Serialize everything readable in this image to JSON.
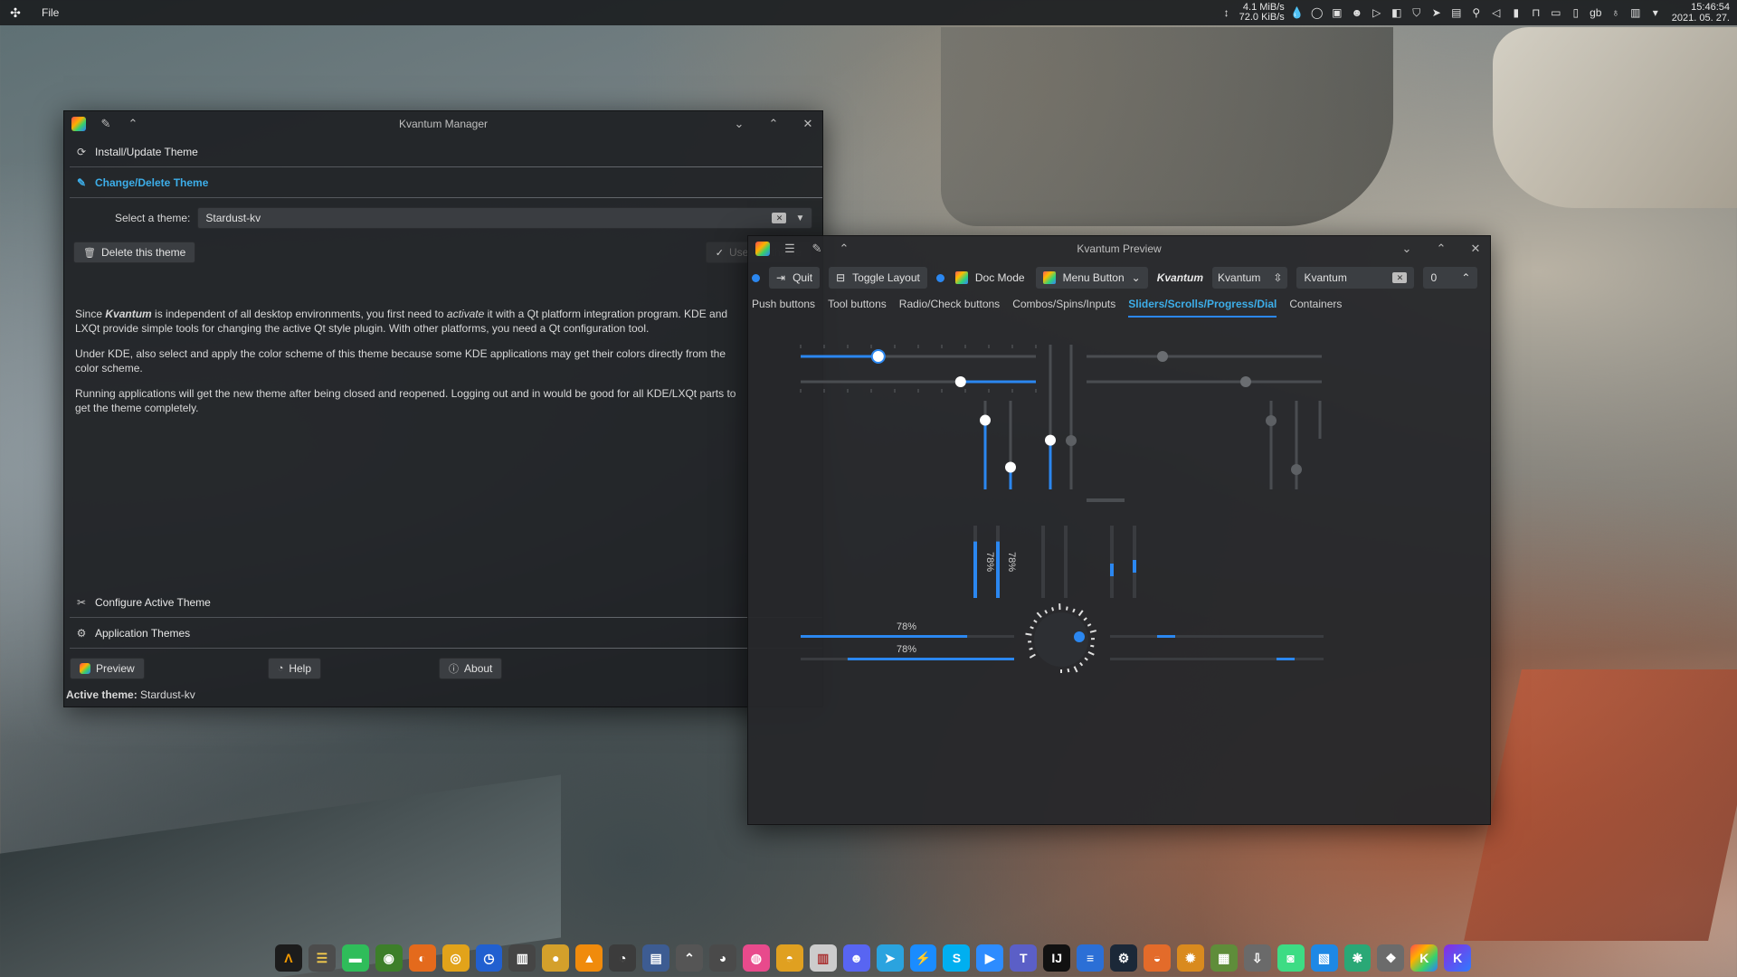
{
  "top_panel": {
    "menu_file": "File",
    "net_down": "4.1 MiB/s",
    "net_up": "72.0 KiB/s",
    "keyboard_layout": "gb",
    "time": "15:46:54",
    "date": "2021. 05. 27."
  },
  "manager": {
    "title": "Kvantum Manager",
    "sections": {
      "install": "Install/Update Theme",
      "change": "Change/Delete Theme",
      "configure": "Configure Active Theme",
      "app_themes": "Application Themes"
    },
    "select_label": "Select a theme:",
    "selected_theme": "Stardust-kv",
    "delete_button": "Delete this theme",
    "use_button": "Use this theme",
    "paragraphs": {
      "p1_a": "Since ",
      "p1_b": "Kvantum",
      "p1_c": " is independent of all desktop environments, you first need to ",
      "p1_d": "activate",
      "p1_e": " it with a Qt platform integration program. KDE and LXQt provide simple tools for changing the active Qt style plugin. With other platforms, you need a Qt configuration tool.",
      "p2": "Under KDE, also select and apply the color scheme of this theme because some KDE applications may get their colors directly from the color scheme.",
      "p3": "Running applications will get the new theme after being closed and reopened. Logging out and in would be good for all KDE/LXQt parts to get the theme completely."
    },
    "bottom_buttons": {
      "preview": "Preview",
      "help": "Help",
      "about": "About"
    },
    "active_theme_label": "Active theme:",
    "active_theme_value": "Stardust-kv"
  },
  "preview": {
    "title": "Kvantum Preview",
    "toolbar": {
      "quit": "Quit",
      "toggle_layout": "Toggle Layout",
      "doc_mode": "Doc Mode",
      "menu_button": "Menu Button",
      "kvantum_label": "Kvantum",
      "combo_value": "Kvantum",
      "line_edit_value": "Kvantum",
      "spin_value": "0"
    },
    "tabs": [
      "Push buttons",
      "Tool buttons",
      "Radio/Check buttons",
      "Combos/Spins/Inputs",
      "Sliders/Scrolls/Progress/Dial",
      "Containers"
    ],
    "progress_value": 0.78,
    "progress_text": "78%",
    "slider_values": {
      "h1": 0.33,
      "h2": 0.68,
      "v1": 0.78,
      "v2": 0.25,
      "v3": 0.34
    }
  },
  "colors": {
    "accent": "#2b87f0",
    "link": "#3daee9",
    "window_bg": "#1e2023"
  }
}
